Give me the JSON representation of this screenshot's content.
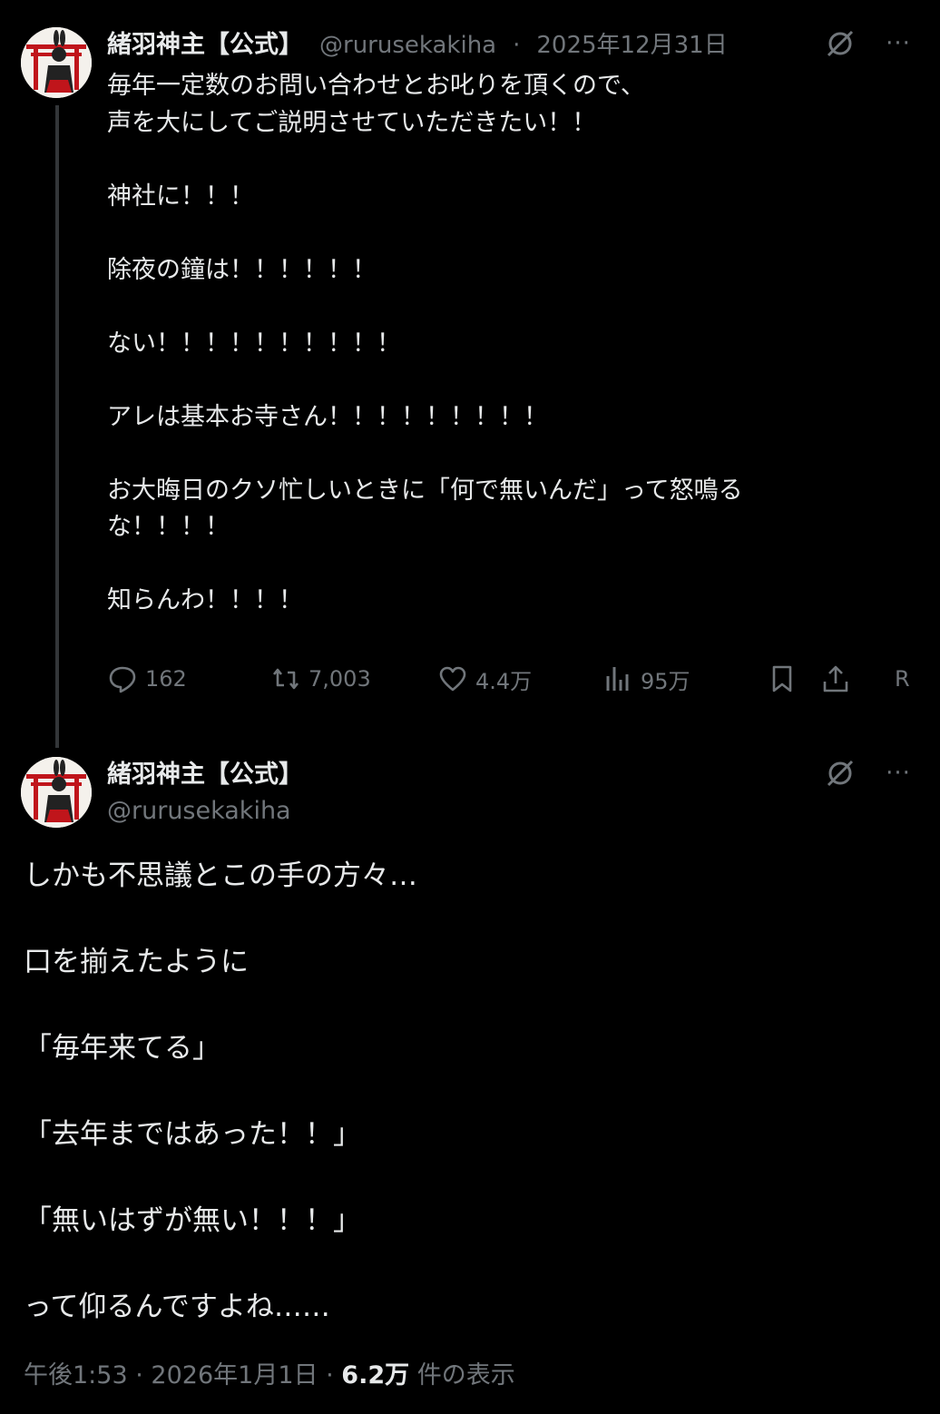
{
  "post1": {
    "author_name": "緒羽神主【公式】",
    "handle": "@rurusekakiha",
    "separator": "·",
    "date": "2025年12月31日",
    "more": "···",
    "body": "毎年一定数のお問い合わせとお叱りを頂くので、\n声を大にしてご説明させていただきたい！！\n\n神社に！！！\n\n除夜の鐘は！！！！！！\n\nない！！！！！！！！！！\n\nアレは基本お寺さん！！！！！！！！！\n\nお大晦日のクソ忙しいときに「何で無いんだ」って怒鳴る\nな！！！！\n\n知らんわ！！！！",
    "stats": {
      "replies": "162",
      "reposts": "7,003",
      "likes": "4.4万",
      "views": "95万",
      "extra": "R"
    },
    "icons": [
      "reply-icon",
      "repost-icon",
      "like-icon",
      "views-icon",
      "bookmark-icon",
      "share-icon",
      "grok-icon",
      "more-icon"
    ]
  },
  "post2": {
    "author_name": "緒羽神主【公式】",
    "handle": "@rurusekakiha",
    "more": "···",
    "body": "しかも不思議とこの手の方々…\n\n口を揃えたように\n\n「毎年来てる」\n\n「去年まではあった！！」\n\n「無いはずが無い！！！」\n\nって仰るんですよね……",
    "time": "午後1:53",
    "separator": "·",
    "date": "2026年1月1日",
    "views_count": "6.2万",
    "views_label": "件の表示"
  },
  "colors": {
    "background": "#000000",
    "text": "#e7e9ea",
    "muted": "#71767b",
    "thread_line": "#333639",
    "avatar_red": "#c0151b"
  }
}
